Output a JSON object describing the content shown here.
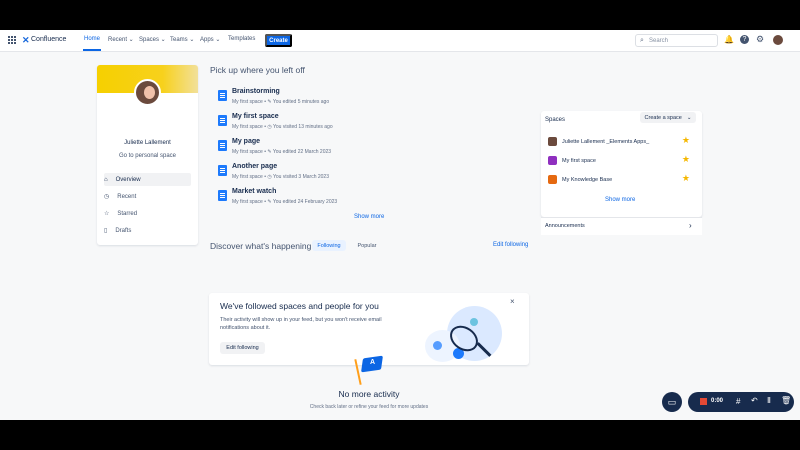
{
  "app": {
    "name": "Confluence"
  },
  "topnav": {
    "items": [
      {
        "label": "Home"
      },
      {
        "label": "Recent ⌄"
      },
      {
        "label": "Spaces ⌄"
      },
      {
        "label": "Teams ⌄"
      },
      {
        "label": "Apps ⌄"
      },
      {
        "label": "Templates"
      }
    ],
    "create_label": "Create",
    "search_placeholder": "Search"
  },
  "profile": {
    "name": "Juliette Lallement",
    "link": "Go to personal space"
  },
  "sidebar": {
    "items": [
      {
        "label": "Overview",
        "icon": "home-icon"
      },
      {
        "label": "Recent",
        "icon": "clock-icon"
      },
      {
        "label": "Starred",
        "icon": "star-outline-icon"
      },
      {
        "label": "Drafts",
        "icon": "draft-icon"
      }
    ]
  },
  "recent": {
    "heading": "Pick up where you left off",
    "items": [
      {
        "title": "Brainstorming",
        "meta": "My first space  •  ✎ You edited 5 minutes ago"
      },
      {
        "title": "My first space",
        "meta": "My first space  •  ◷ You visited 13 minutes ago"
      },
      {
        "title": "My page",
        "meta": "My first space  •  ✎ You edited 22 March 2023"
      },
      {
        "title": "Another page",
        "meta": "My first space  •  ◷ You visited 3 March 2023"
      },
      {
        "title": "Market watch",
        "meta": "My first space  •  ✎ You edited 24 February 2023"
      }
    ],
    "show_more": "Show more"
  },
  "discover": {
    "heading": "Discover what's happening",
    "tab_following": "Following",
    "tab_popular": "Popular",
    "edit_following": "Edit following",
    "card_title": "We've followed spaces and people for you",
    "card_text": "Their activity will show up in your feed, but you won't receive email notifications about it.",
    "card_button": "Edit following",
    "empty_title": "No more activity",
    "empty_text": "Check back later or refine your feed for more updates"
  },
  "spaces": {
    "heading": "Spaces",
    "create_label": "Create a space",
    "items": [
      {
        "label": "Juliette Lallement _Elements Apps_",
        "icon": "avatar-icon",
        "color": "#6b4a3d"
      },
      {
        "label": "My first space",
        "icon": "space-icon",
        "color": "#8f2fbf"
      },
      {
        "label": "My Knowledge Base",
        "icon": "knowledge-base-icon",
        "color": "#e56910"
      }
    ],
    "show_more": "Show more",
    "announcements": "Announcements"
  },
  "recorder": {
    "time": "0:00"
  },
  "colors": {
    "brand": "#0c66e4",
    "accent_yellow": "#f6d000",
    "text": "#172b4d"
  }
}
